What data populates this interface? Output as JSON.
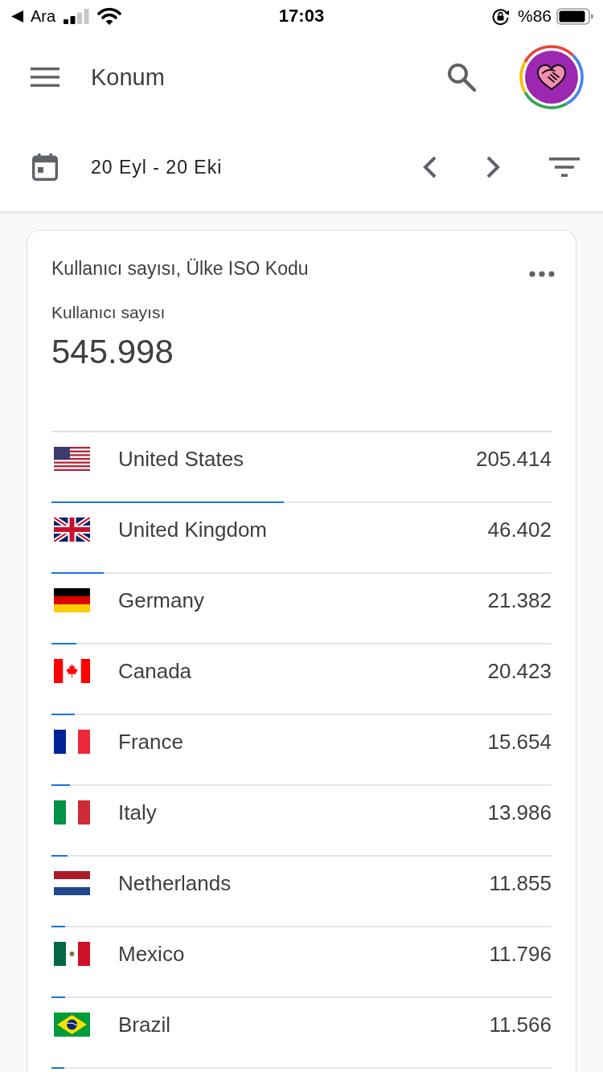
{
  "status_bar": {
    "back_label": "Ara",
    "time": "17:03",
    "battery": "%86"
  },
  "app_bar": {
    "title": "Konum"
  },
  "date_bar": {
    "range": "20 Eyl - 20 Eki"
  },
  "card": {
    "title": "Kullanıcı sayısı, Ülke ISO Kodu",
    "metric_label": "Kullanıcı sayısı",
    "metric_value": "545.998",
    "rows": [
      {
        "kind": "us",
        "country": "United States",
        "value": "205.414",
        "level": 0.465
      },
      {
        "kind": "gb",
        "country": "United Kingdom",
        "value": "46.402",
        "level": 0.105
      },
      {
        "kind": "de",
        "country": "Germany",
        "value": "21.382",
        "level": 0.05
      },
      {
        "kind": "ca",
        "country": "Canada",
        "value": "20.423",
        "level": 0.047
      },
      {
        "kind": "fr",
        "country": "France",
        "value": "15.654",
        "level": 0.037
      },
      {
        "kind": "it",
        "country": "Italy",
        "value": "13.986",
        "level": 0.032
      },
      {
        "kind": "nl",
        "country": "Netherlands",
        "value": "11.855",
        "level": 0.027
      },
      {
        "kind": "mx",
        "country": "Mexico",
        "value": "11.796",
        "level": 0.027
      },
      {
        "kind": "br",
        "country": "Brazil",
        "value": "11.566",
        "level": 0.026
      }
    ]
  }
}
